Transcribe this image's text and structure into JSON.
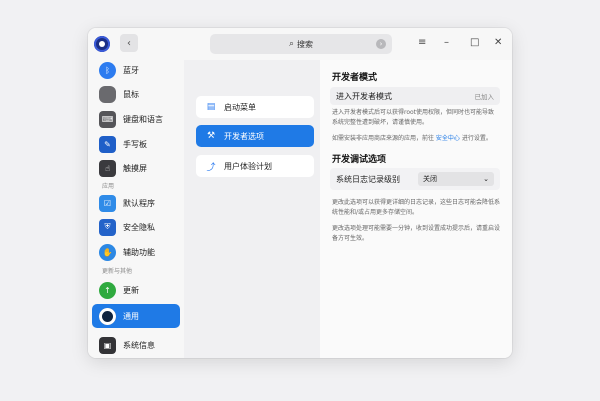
{
  "titlebar": {
    "back_icon": "chevron-left-icon",
    "search_label": "搜索",
    "menu_icon": "≡",
    "minimize_icon": "–",
    "maximize_icon": "□",
    "close_icon": "✕"
  },
  "sidebar": {
    "items": [
      {
        "label": "蓝牙",
        "icon": "bluetooth-icon",
        "color": "#2d7cf0"
      },
      {
        "label": "鼠标",
        "icon": "mouse-icon",
        "color": "#6a6a6e"
      },
      {
        "label": "键盘和语言",
        "icon": "keyboard-icon",
        "color": "#555559"
      },
      {
        "label": "手写板",
        "icon": "tablet-icon",
        "color": "#1f5fc8"
      },
      {
        "label": "触摸屏",
        "icon": "touchscreen-icon",
        "color": "#3a3a3e"
      },
      {
        "label": "默认程序",
        "icon": "default-apps-icon",
        "color": "#2f8be8"
      },
      {
        "label": "安全隐私",
        "icon": "shield-icon",
        "color": "#2463c9"
      },
      {
        "label": "辅助功能",
        "icon": "accessibility-icon",
        "color": "#2c88e4"
      },
      {
        "label": "更新",
        "icon": "update-icon",
        "color": "#2faa3f"
      },
      {
        "label": "通用",
        "icon": "general-icon",
        "color": "#0f2440"
      },
      {
        "label": "系统信息",
        "icon": "system-info-icon",
        "color": "#333336"
      }
    ],
    "section_apps": "应用",
    "section_more": "更新与其他"
  },
  "middle": {
    "items": [
      {
        "label": "启动菜单",
        "icon": "boot-menu-icon"
      },
      {
        "label": "开发者选项",
        "icon": "tools-icon"
      },
      {
        "label": "用户体验计划",
        "icon": "chart-icon"
      }
    ]
  },
  "content": {
    "dev_mode_title": "开发者模式",
    "dev_mode_row_label": "进入开发者模式",
    "dev_mode_row_status": "已加入",
    "dev_mode_desc": "进入开发者模式后可以获得root使用权限，但同时也可能导致系统完整性遭到破坏，请谨慎使用。",
    "install_desc_prefix": "如需安装非应用商店来源的应用，前往 ",
    "install_desc_link": "安全中心",
    "install_desc_suffix": " 进行设置。",
    "debug_title": "开发调试选项",
    "log_level_label": "系统日志记录级别",
    "log_level_value": "关闭",
    "log_desc_1": "更改此选项可以获得更详细的日志记录，这些日志可能会降低系统性能和/或占用更多存储空间。",
    "log_desc_2": "更改选项处理可能需要一分钟，收到设置成功提示后，请重启设备方可生效。"
  },
  "colors": {
    "accent": "#1f7ae6"
  }
}
